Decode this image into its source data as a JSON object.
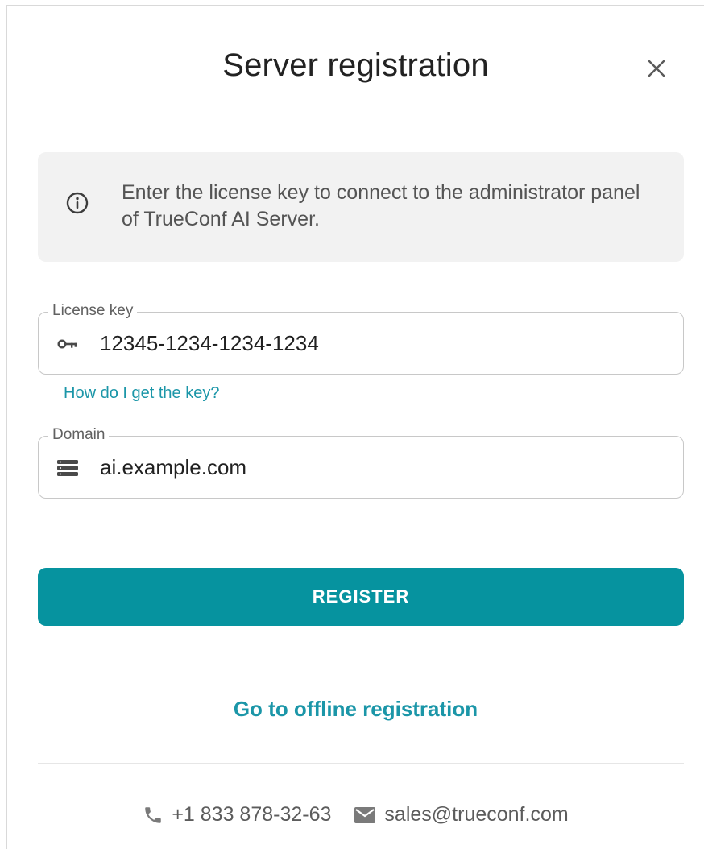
{
  "dialog": {
    "title": "Server registration",
    "close_icon": "close-icon"
  },
  "info": {
    "icon": "info-icon",
    "text": "Enter the license key to connect to the administrator panel of TrueConf AI Server."
  },
  "license_field": {
    "legend": "License key",
    "icon": "key-icon",
    "value": "12345-1234-1234-1234"
  },
  "help_link": "How do I get the key?",
  "domain_field": {
    "legend": "Domain",
    "icon": "server-icon",
    "value": "ai.example.com"
  },
  "register_button": "REGISTER",
  "offline_link": "Go to offline registration",
  "contacts": {
    "phone_icon": "phone-icon",
    "phone": "+1 833 878-32-63",
    "email_icon": "email-icon",
    "email": "sales@trueconf.com"
  },
  "colors": {
    "accent": "#06939f",
    "link": "#1b96a8",
    "info_bg": "#f2f2f2"
  }
}
